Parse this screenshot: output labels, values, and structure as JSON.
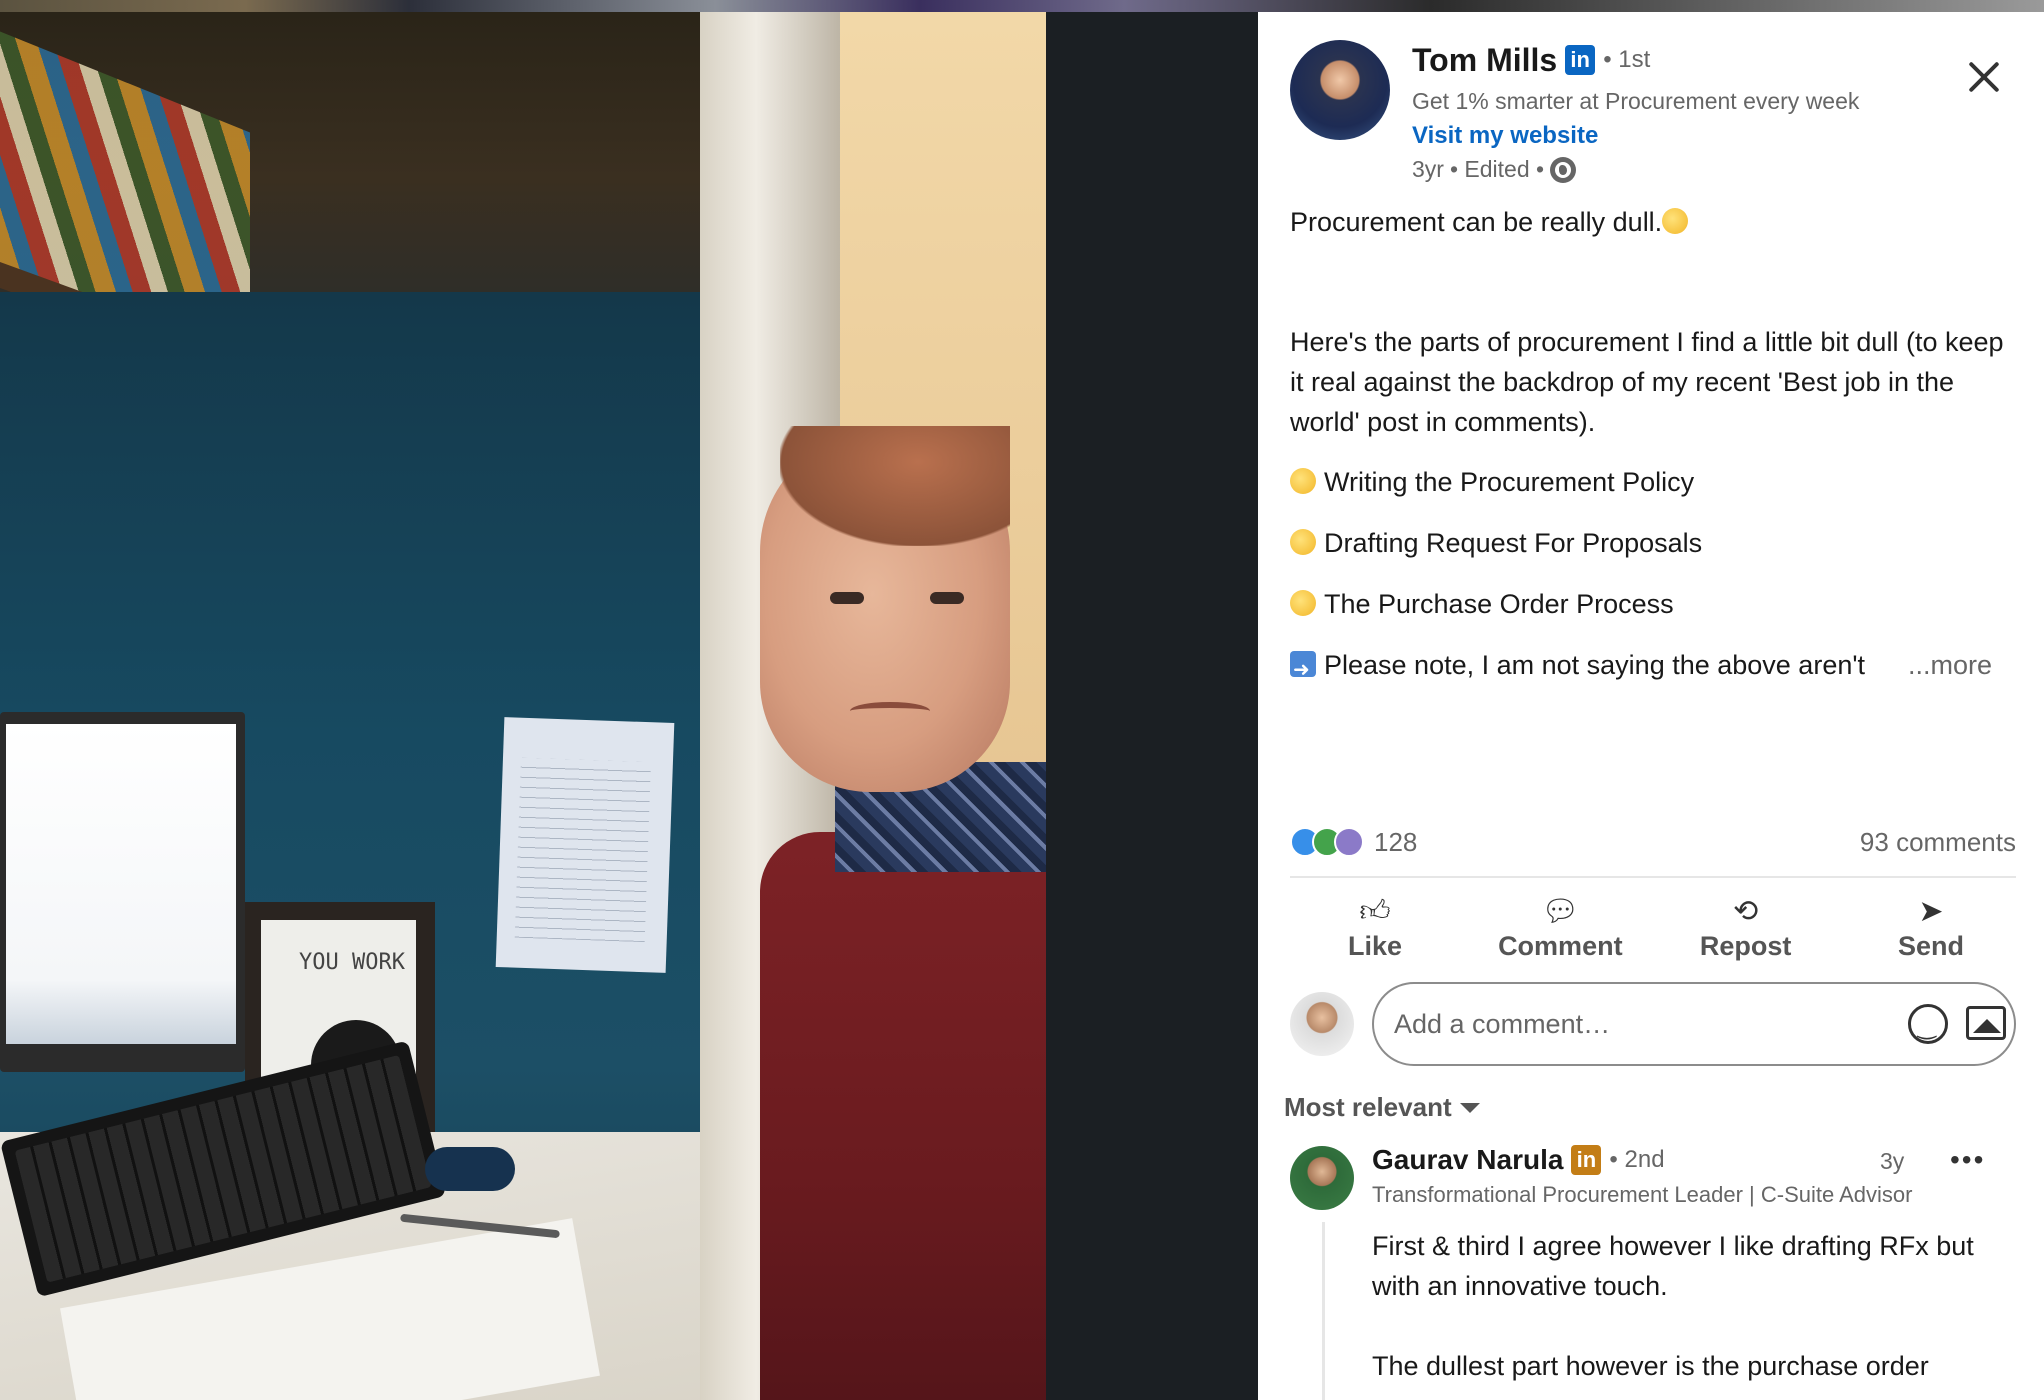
{
  "post": {
    "author": {
      "name": "Tom Mills",
      "badge": "in",
      "degree": "• 1st",
      "headline": "Get 1% smarter at Procurement every week",
      "website_label": "Visit my website",
      "time": "3yr",
      "edited": "• Edited •"
    },
    "text": {
      "line1": "Procurement can be really dull.",
      "para2": "Here's the parts of procurement I find a little bit dull (to keep it real against the backdrop of my recent 'Best job in the world' post in comments).",
      "item1": "Writing the Procurement Policy",
      "item2": "Drafting Request For Proposals",
      "item3": "The Purchase Order Process",
      "truncated": "Please note, I am not saying the above aren't",
      "more_label": "...more"
    },
    "reactions_count": "128",
    "comments_count": "93 comments",
    "actions": {
      "like": "Like",
      "comment": "Comment",
      "repost": "Repost",
      "send": "Send"
    }
  },
  "comment_input": {
    "placeholder": "Add a comment…"
  },
  "sort_label": "Most relevant",
  "comments": [
    {
      "name": "Gaurav Narula",
      "badge": "in",
      "degree": "• 2nd",
      "headline": "Transformational Procurement Leader | C-Suite Advisor",
      "time": "3y",
      "more": "•••",
      "para1": "First & third I agree however I like drafting RFx but with an innovative touch.",
      "para2": "The dullest part however is the purchase order"
    }
  ],
  "photo": {
    "frame_text": "YOU WORK"
  },
  "icons": {
    "close": "close-icon",
    "like": "thumbs-up-icon",
    "comment": "speech-bubble-icon",
    "repost": "repost-arrows-icon",
    "send": "paper-plane-icon",
    "emoji": "smiley-icon",
    "image": "image-icon",
    "globe": "globe-icon"
  },
  "colors": {
    "brand": "#0a66c2",
    "premium_badge": "#c37d16",
    "text_primary": "#191919",
    "text_secondary": "#666666",
    "media_background": "#1b1f23"
  }
}
